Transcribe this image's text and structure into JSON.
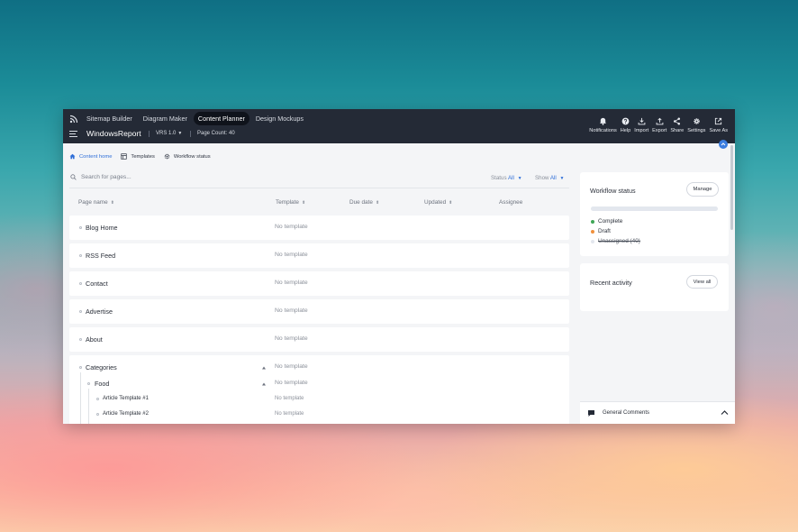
{
  "topbar": {
    "tabs": [
      {
        "label": "Sitemap Builder",
        "active": false
      },
      {
        "label": "Diagram Maker",
        "active": false
      },
      {
        "label": "Content Planner",
        "active": true
      },
      {
        "label": "Design Mockups",
        "active": false
      }
    ],
    "brand": "WindowsReport",
    "version": "VRS 1.0",
    "page_count": "Page Count: 40",
    "tools": [
      {
        "label": "Notifications",
        "icon": "bell-icon"
      },
      {
        "label": "Help",
        "icon": "help-icon"
      },
      {
        "label": "Import",
        "icon": "import-icon"
      },
      {
        "label": "Export",
        "icon": "export-icon"
      },
      {
        "label": "Share",
        "icon": "share-icon"
      },
      {
        "label": "Settings",
        "icon": "gear-icon"
      },
      {
        "label": "Save As",
        "icon": "save-as-icon"
      }
    ]
  },
  "breadcrumbs": [
    {
      "label": "Content home",
      "icon": "home-icon",
      "active": true
    },
    {
      "label": "Templates",
      "icon": "templates-icon",
      "active": false
    },
    {
      "label": "Workflow status",
      "icon": "workflow-icon",
      "active": false
    }
  ],
  "search": {
    "placeholder": "Search for pages..."
  },
  "filters": {
    "status_label": "Status",
    "status_value": "All",
    "show_label": "Show",
    "show_value": "All"
  },
  "columns": [
    "Page name",
    "Template",
    "Due date",
    "Updated",
    "Assignee"
  ],
  "rows": [
    {
      "name": "Blog Home",
      "template": "No template"
    },
    {
      "name": "RSS Feed",
      "template": "No template"
    },
    {
      "name": "Contact",
      "template": "No template"
    },
    {
      "name": "Advertise",
      "template": "No template"
    },
    {
      "name": "About",
      "template": "No template"
    }
  ],
  "group": {
    "name": "Categories",
    "template": "No template",
    "child": {
      "name": "Food",
      "template": "No template"
    },
    "items": [
      {
        "name": "Article Template #1",
        "template": "No template"
      },
      {
        "name": "Article Template #2",
        "template": "No template"
      }
    ]
  },
  "workflow": {
    "title": "Workflow status",
    "button": "Manage",
    "legend": [
      {
        "label": "Complete",
        "color": "#3fa657"
      },
      {
        "label": "Draft",
        "color": "#f0903c"
      },
      {
        "label": "Unassigned (40)",
        "color": "#e3e7ee"
      }
    ]
  },
  "activity": {
    "title": "Recent activity",
    "button": "View all"
  },
  "comments": {
    "label": "General Comments"
  },
  "colors": {
    "topbar": "#242a36",
    "accent": "#2f6fd8"
  }
}
